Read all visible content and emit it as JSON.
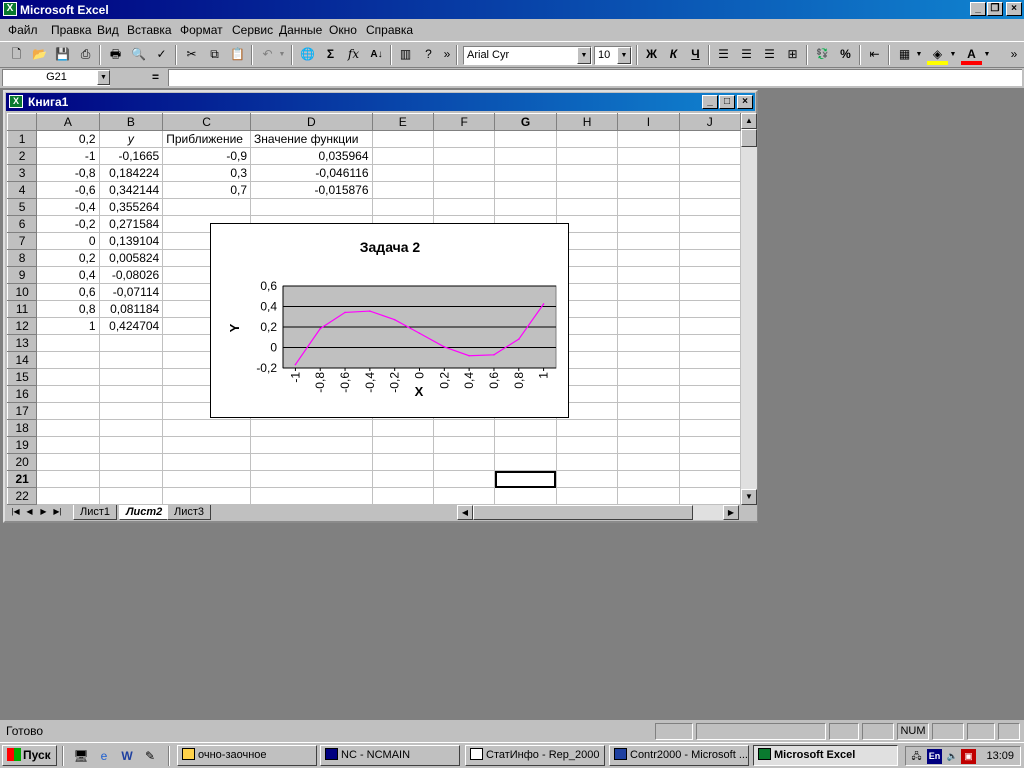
{
  "app": {
    "title": "Microsoft Excel"
  },
  "menu": [
    "Файл",
    "Правка",
    "Вид",
    "Вставка",
    "Формат",
    "Сервис",
    "Данные",
    "Окно",
    "Справка"
  ],
  "toolbar": {
    "font_name": "Arial Cyr",
    "font_size": "10",
    "bold": "Ж",
    "italic": "К",
    "underline": "Ч",
    "percent": "%",
    "sigma": "Σ",
    "fx": "fx"
  },
  "formula_bar": {
    "name_box": "G21",
    "equals": "=",
    "content": ""
  },
  "workbook": {
    "title": "Книга1",
    "columns": [
      "A",
      "B",
      "C",
      "D",
      "E",
      "F",
      "G",
      "H",
      "I",
      "J"
    ],
    "rows": [
      [
        "0,2",
        "y",
        "Приближение",
        "Значение функции"
      ],
      [
        "-1",
        "-0,1665",
        "-0,9",
        "0,035964"
      ],
      [
        "-0,8",
        "0,184224",
        "0,3",
        "-0,046116"
      ],
      [
        "-0,6",
        "0,342144",
        "0,7",
        "-0,015876"
      ],
      [
        "-0,4",
        "0,355264",
        "",
        ""
      ],
      [
        "-0,2",
        "0,271584",
        "",
        ""
      ],
      [
        "0",
        "0,139104",
        "",
        ""
      ],
      [
        "0,2",
        "0,005824",
        "",
        ""
      ],
      [
        "0,4",
        "-0,08026",
        "",
        ""
      ],
      [
        "0,6",
        "-0,07114",
        "",
        ""
      ],
      [
        "0,8",
        "0,081184",
        "",
        ""
      ],
      [
        "1",
        "0,424704",
        "",
        ""
      ],
      [
        "",
        "",
        "",
        ""
      ],
      [
        "",
        "",
        "",
        ""
      ],
      [
        "",
        "",
        "",
        ""
      ],
      [
        "",
        "",
        "",
        ""
      ],
      [
        "",
        "",
        "",
        ""
      ],
      [
        "",
        "",
        "",
        ""
      ],
      [
        "",
        "",
        "",
        ""
      ],
      [
        "",
        "",
        "",
        ""
      ],
      [
        "",
        "",
        "",
        ""
      ],
      [
        "",
        "",
        "",
        ""
      ]
    ],
    "selected_cell": "G21",
    "sheet_tabs": [
      "Лист1",
      "Лист2",
      "Лист3"
    ],
    "active_sheet": "Лист2"
  },
  "chart_data": {
    "type": "line",
    "title": "Задача 2",
    "xlabel": "X",
    "ylabel": "Y",
    "categories": [
      "-1",
      "-0,8",
      "-0,6",
      "-0,4",
      "-0,2",
      "0",
      "0,2",
      "0,4",
      "0,6",
      "0,8",
      "1"
    ],
    "values": [
      -0.1665,
      0.184224,
      0.342144,
      0.355264,
      0.271584,
      0.139104,
      0.005824,
      -0.08026,
      -0.07114,
      0.081184,
      0.424704
    ],
    "ylim": [
      -0.2,
      0.6
    ],
    "yticks": [
      "-0,2",
      "0",
      "0,2",
      "0,4",
      "0,6"
    ],
    "grid": true,
    "plot_background": "#c0c0c0",
    "line_color": "#ff00ff"
  },
  "status": {
    "text": "Готово",
    "num": "NUM"
  },
  "taskbar": {
    "start": "Пуск",
    "tasks": [
      "очно-заочное",
      "NC - NCMAIN",
      "СтатИнфо - Rep_2000",
      "Contr2000 - Microsoft ...",
      "Microsoft Excel"
    ],
    "active_task": "Microsoft Excel",
    "lang": "En",
    "clock": "13:09"
  }
}
